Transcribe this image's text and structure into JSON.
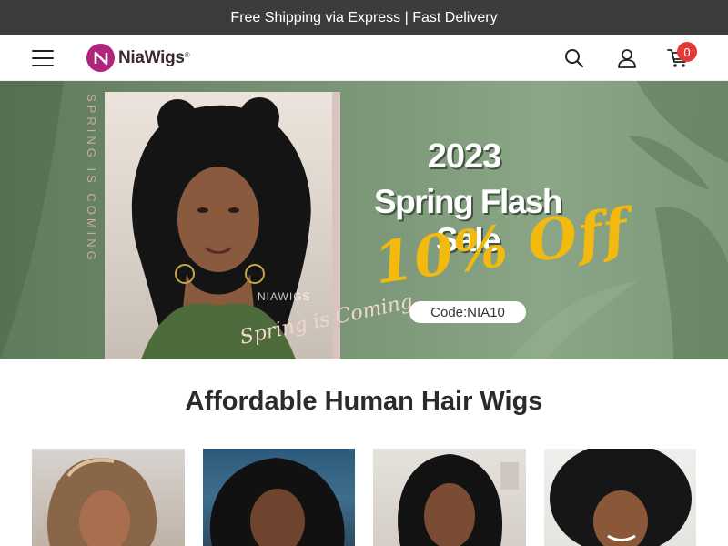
{
  "announcement": {
    "text": "Free Shipping via Express | Fast Delivery"
  },
  "header": {
    "logo_text": "NiaWigs",
    "logo_mark": "®",
    "cart_count": "0",
    "icons": [
      "menu-icon",
      "search-icon",
      "account-icon",
      "cart-icon"
    ]
  },
  "banner": {
    "vertical_text": "SPRING IS COMING",
    "year": "2023",
    "title": "Spring Flash Sale",
    "discount": "10% Off",
    "code": "Code:NIA10",
    "watermark": "NIAWIGS",
    "script": "Spring is Coming"
  },
  "section": {
    "title": "Affordable Human Hair Wigs"
  },
  "products": [
    {
      "alt": "curly brown wig"
    },
    {
      "alt": "deep wave black wig"
    },
    {
      "alt": "kinky straight wig"
    },
    {
      "alt": "afro kinky curly wig"
    }
  ],
  "colors": {
    "announcement_bg": "#3c3c3c",
    "brand": "#b0247f",
    "badge": "#e53935",
    "banner_green": "#7e9a7a",
    "sale_yellow": "#f2b90f"
  }
}
